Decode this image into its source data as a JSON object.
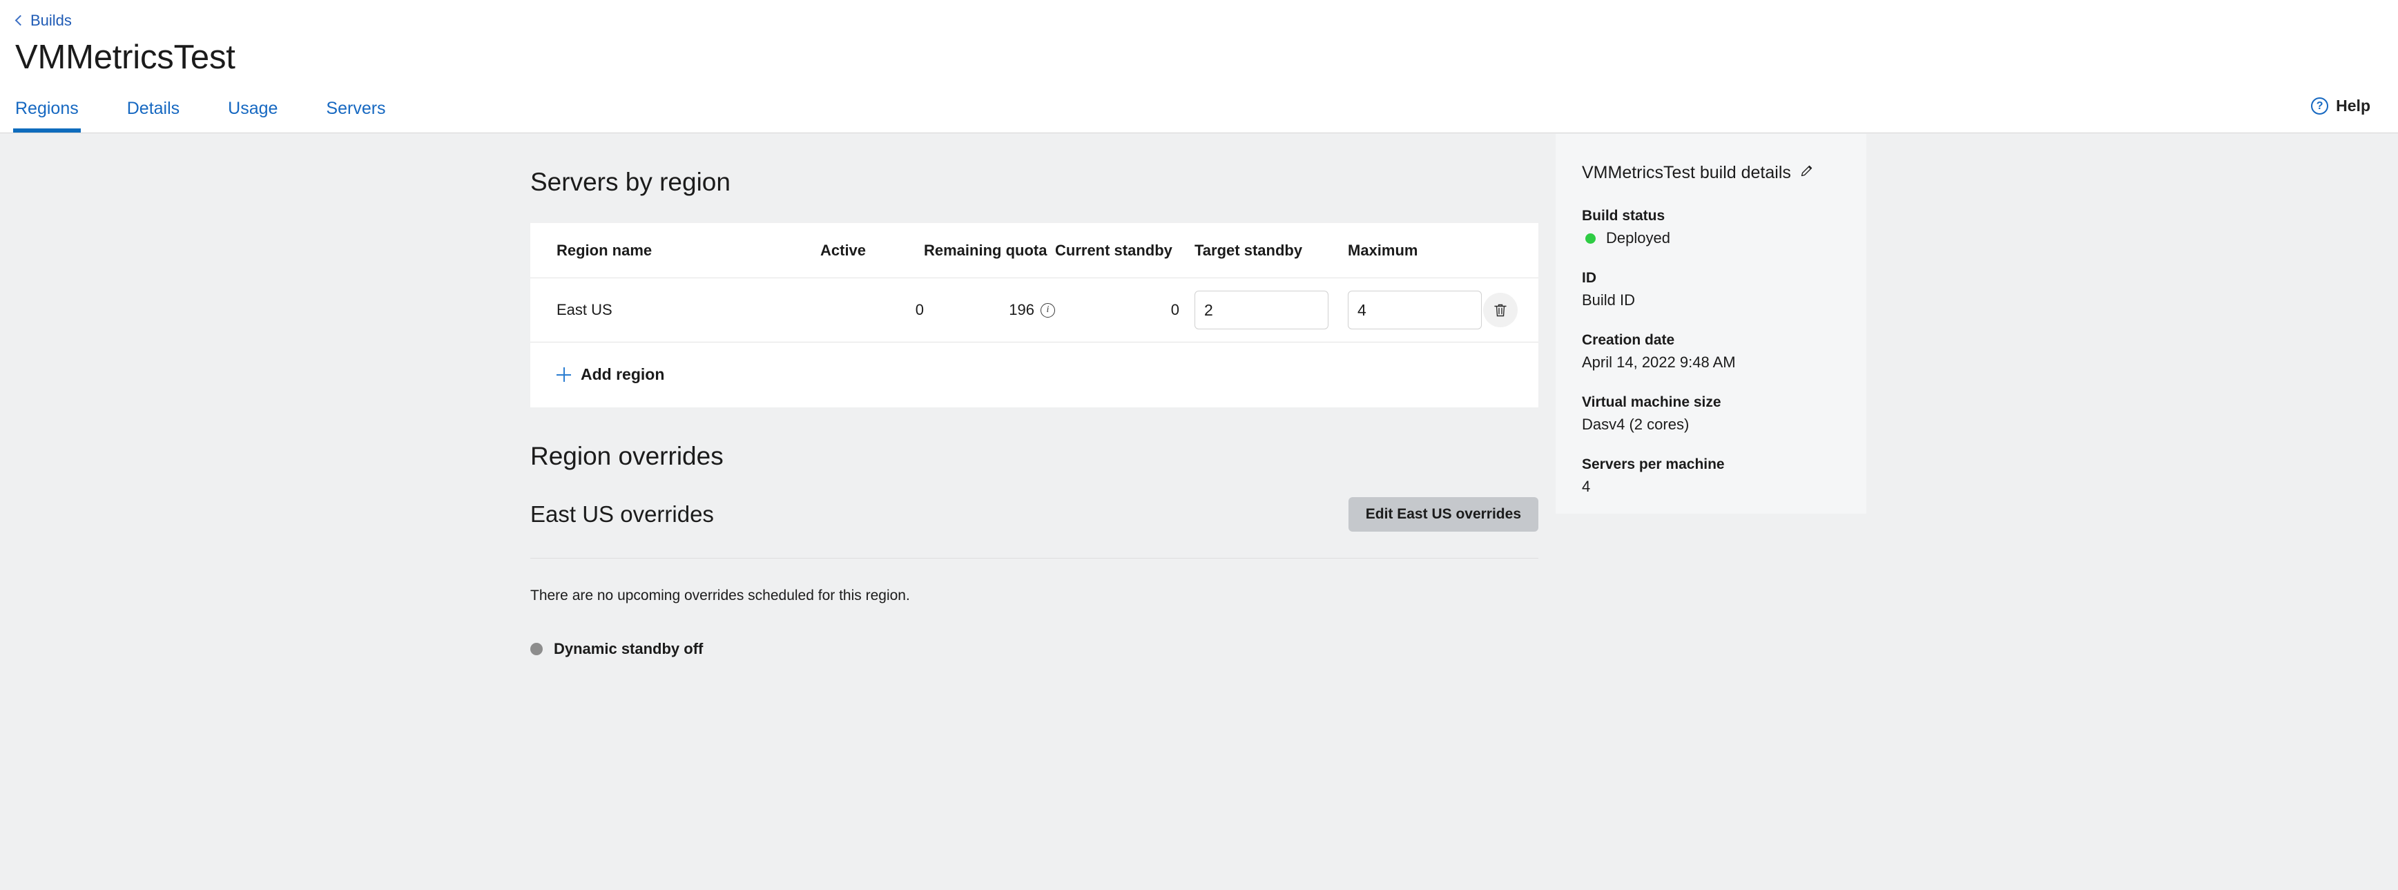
{
  "header": {
    "back_label": "Builds",
    "title": "VMMetricsTest",
    "tabs": [
      {
        "label": "Regions",
        "active": true
      },
      {
        "label": "Details",
        "active": false
      },
      {
        "label": "Usage",
        "active": false
      },
      {
        "label": "Servers",
        "active": false
      }
    ],
    "help_label": "Help",
    "help_icon": "question-mark",
    "back_icon": "chevron-left-icon"
  },
  "servers_by_region": {
    "title": "Servers by region",
    "columns": [
      "Region name",
      "Active",
      "Remaining quota",
      "Current standby",
      "Target standby",
      "Maximum"
    ],
    "rows": [
      {
        "region_name": "East US",
        "active": "0",
        "remaining_quota": "196",
        "current_standby": "0",
        "target_standby": "2",
        "maximum": "4"
      }
    ],
    "add_region_label": "Add region"
  },
  "region_overrides": {
    "title": "Region overrides",
    "subtitle": "East US overrides",
    "edit_button": "Edit East US overrides",
    "empty_message": "There are no upcoming overrides scheduled for this region.",
    "dynamic_standby": "Dynamic standby off"
  },
  "build_details": {
    "title": "VMMetricsTest build details",
    "fields": [
      {
        "label": "Build status",
        "value": "Deployed"
      },
      {
        "label": "ID",
        "value": "Build ID"
      },
      {
        "label": "Creation date",
        "value": "April 14, 2022 9:48 AM"
      },
      {
        "label": "Virtual machine size",
        "value": "Dasv4 (2 cores)"
      },
      {
        "label": "Servers per machine",
        "value": "4"
      }
    ]
  },
  "colors": {
    "accent_blue": "#0f6cbd",
    "link_blue": "#1668c1",
    "status_green": "#2ecc44",
    "page_bg": "#eff0f1",
    "panel_bg": "#f5f6f7",
    "button_gray": "#c5c8cc"
  }
}
